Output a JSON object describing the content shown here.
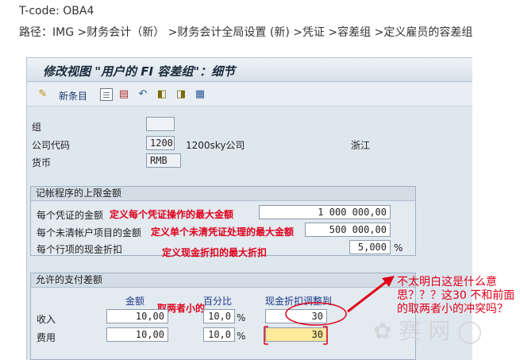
{
  "header": {
    "tcode": "T-code: OBA4",
    "path": "路径：IMG >财务会计（新） >财务会计全局设置 (新) >凭证 >容差组 >定义雇员的容差组"
  },
  "window": {
    "title": "修改视图 \"用户的 FI 容差组\"：细节"
  },
  "toolbar": {
    "new_entries": "新条目"
  },
  "fields": {
    "group_label": "组",
    "group_value": "",
    "company_code_label": "公司代码",
    "company_code_value": "1200",
    "company_name": "1200sky公司",
    "city": "浙江",
    "currency_label": "货币",
    "currency_value": "RMB"
  },
  "posting_limits": {
    "title": "记帐程序的上限金额",
    "rows": [
      {
        "label": "每个凭证的金额",
        "value": "1 000 000,00",
        "note": "定义每个凭证操作的最大金额"
      },
      {
        "label": "每个未清帐户项目的金额",
        "value": "500 000,00",
        "note": "定义单个未清凭证处理的最大金额"
      },
      {
        "label": "每个行项的现金折扣",
        "value": "5,000",
        "unit": "%",
        "note": "定义现金折扣的最大折扣"
      }
    ]
  },
  "payment_diff": {
    "title": "允许的支付差额",
    "col_amount": "金额",
    "col_percent": "百分比",
    "col_cash_discount": "现金折扣调整到",
    "note": "取两者小的",
    "rows": [
      {
        "label": "收入",
        "amount": "10,00",
        "percent": "10,0",
        "unit": "%",
        "cash_discount": "30"
      },
      {
        "label": "费用",
        "amount": "10,00",
        "percent": "10,0",
        "unit": "%",
        "cash_discount": "30"
      }
    ]
  },
  "side_note": "不太明白这是什么意思？？？这30 不和前面的取两者小的冲突吗？",
  "colors": {
    "annotation": "#e0001b",
    "highlight": "#ffe99a",
    "sap_background": "#dfe7ee"
  }
}
